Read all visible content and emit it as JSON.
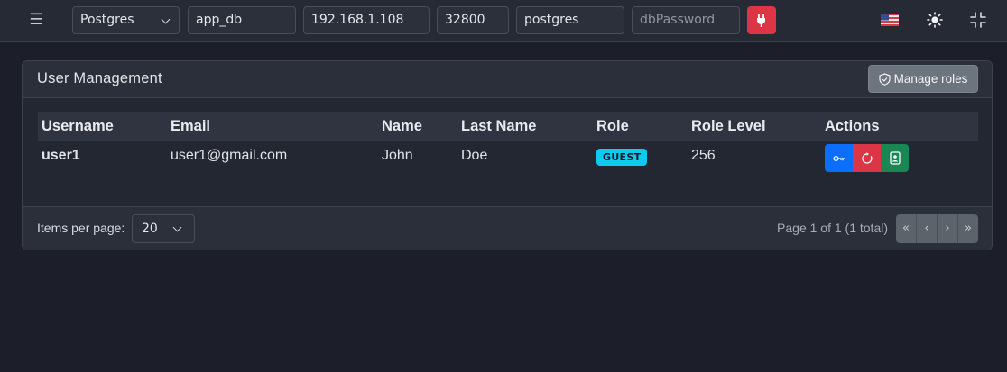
{
  "topbar": {
    "menu_icon": "hamburger-menu-icon",
    "db_type": "Postgres",
    "db_name": "app_db",
    "host": "192.168.1.108",
    "port": "32800",
    "user": "postgres",
    "password_placeholder": "dbPassword",
    "connect_icon": "plug-icon",
    "language_icon": "us-flag-icon",
    "theme_icon": "sun-icon",
    "collapse_icon": "compress-icon"
  },
  "card": {
    "title": "User Management",
    "manage_roles_label": "Manage roles",
    "manage_roles_icon": "shield-check-icon"
  },
  "table": {
    "columns": [
      "Username",
      "Email",
      "Name",
      "Last Name",
      "Role",
      "Role Level",
      "Actions"
    ],
    "rows": [
      {
        "username": "user1",
        "email": "user1@gmail.com",
        "name": "John",
        "last_name": "Doe",
        "role": "GUEST",
        "role_level": "256",
        "actions": [
          {
            "icon": "key-icon",
            "color": "#0d6efd"
          },
          {
            "icon": "reset-icon",
            "color": "#dc3545"
          },
          {
            "icon": "id-card-icon",
            "color": "#198754"
          }
        ]
      }
    ]
  },
  "footer": {
    "items_per_page_label": "Items per page:",
    "items_per_page_value": "20",
    "page_info": "Page 1 of 1 (1 total)",
    "pager": [
      "«",
      "‹",
      "›",
      "»"
    ]
  },
  "colors": {
    "background": "#1c1f2a",
    "danger": "#dc3545",
    "primary": "#0d6efd",
    "success": "#198754",
    "info_badge": "#0dcaf0",
    "secondary": "#6c757d"
  }
}
